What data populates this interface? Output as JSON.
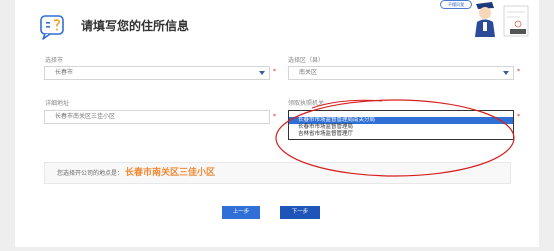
{
  "header": {
    "title": "请填写您的住所信息",
    "mascot_bubble": "不懂问我"
  },
  "form": {
    "city": {
      "label": "选择市",
      "value": "长春市"
    },
    "district": {
      "label": "选择区（县）",
      "value": "南关区"
    },
    "address": {
      "label": "详细地址",
      "placeholder": "长春市南关区三佳小区"
    },
    "authority": {
      "label": "领取执照机关",
      "options": [
        "",
        "长春市市场监督管理局南关分局",
        "长春市市场监督管理局",
        "吉林省市场监督管理厅"
      ],
      "selected_index": 1
    },
    "required_mark": "*"
  },
  "summary": {
    "prefix": "您选择开公司的地点是：",
    "address": "长春市南关区三佳小区"
  },
  "buttons": {
    "prev": "上一步",
    "next": "下一步"
  },
  "colors": {
    "accent": "#2f6fd6",
    "highlight_ring": "#d62020",
    "address_text": "#f28a35"
  }
}
